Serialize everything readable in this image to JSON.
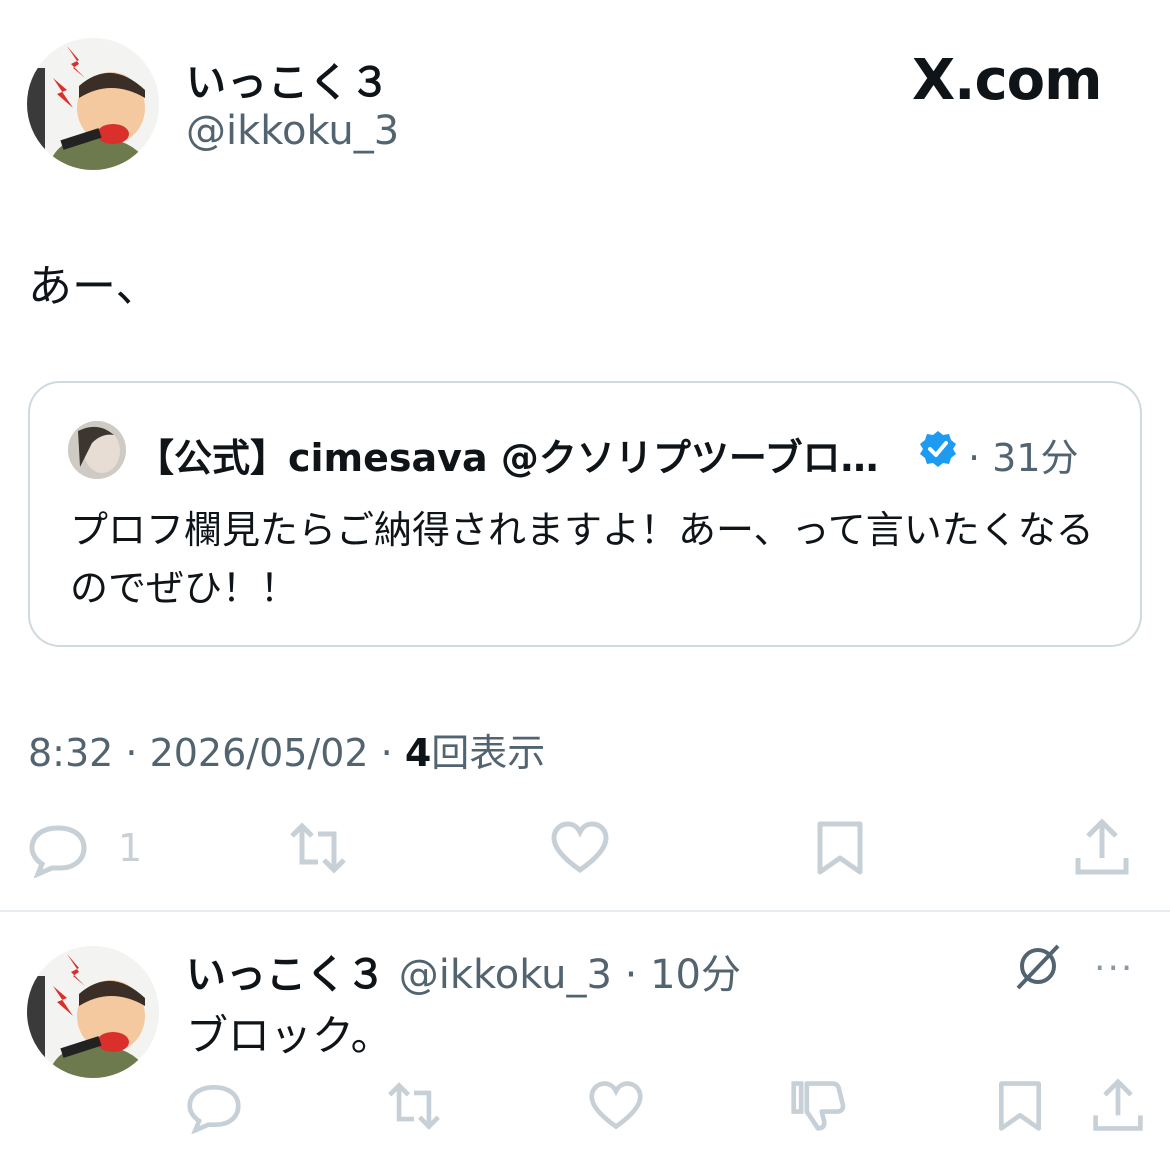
{
  "post": {
    "author_name": "いっこく３",
    "author_handle": "@ikkoku_3",
    "site_label": "X.com",
    "text": "あー、",
    "timestamp": "8:32 · 2026/05/02 · ",
    "views_count": "4",
    "views_label": "回表示",
    "reply_count": "1"
  },
  "quote": {
    "author_name": "【公式】cimesava @クソリプツーブロ…",
    "time": "· 31分",
    "text": "プロフ欄見たらご納得されますよ！あー、って言いたくなるのでぜひ！！"
  },
  "reply": {
    "author_name": "いっこく３",
    "author_handle": " @ikkoku_3",
    "time": " · 10分",
    "text": "ブロック。",
    "more_label": "···"
  },
  "icons": {
    "reply": "reply-icon",
    "repost": "repost-icon",
    "like": "like-icon",
    "bookmark": "bookmark-icon",
    "share": "share-icon",
    "grok": "grok-icon",
    "dislike": "dislike-icon",
    "verified": "verified-badge-icon"
  },
  "colors": {
    "verified": "#1d9bf0",
    "secondary_text": "#536471",
    "icon_gray": "#c7d0d6"
  }
}
